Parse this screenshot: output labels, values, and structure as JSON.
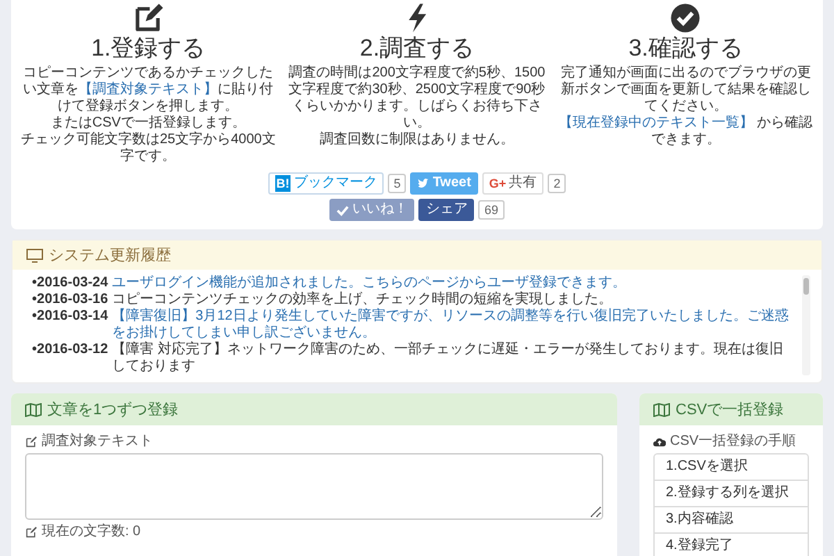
{
  "steps": [
    {
      "kind": "edit",
      "title": "1.登録する",
      "paragraphs": [
        [
          {
            "text": "コピーコンテンツであるかチェックしたい文章を",
            "link": false
          },
          {
            "text": "【調査対象テキスト】",
            "link": true
          },
          {
            "text": "に貼り付けて登録ボタンを押します。",
            "link": false
          }
        ],
        [
          {
            "text": "またはCSVで一括登録します。",
            "link": false
          }
        ],
        [
          {
            "text": "チェック可能文字数は25文字から4000文字です。",
            "link": false
          }
        ]
      ]
    },
    {
      "kind": "bolt",
      "title": "2.調査する",
      "paragraphs": [
        [
          {
            "text": "調査の時間は200文字程度で約5秒、1500文字程度で約30秒、2500文字程度で90秒くらいかかります。しばらくお待ち下さい。",
            "link": false
          }
        ],
        [
          {
            "text": "調査回数に制限はありません。",
            "link": false
          }
        ]
      ]
    },
    {
      "kind": "check",
      "title": "3.確認する",
      "paragraphs": [
        [
          {
            "text": "完了通知が画面に出るのでブラウザの更新ボタンで画面を更新して結果を確認してください。",
            "link": false
          }
        ],
        [
          {
            "text": "【現在登録中のテキスト一覧】",
            "link": true
          },
          {
            "text": " から確認できます。",
            "link": false
          }
        ]
      ]
    }
  ],
  "social": [
    [
      {
        "kind": "hatena",
        "icon": "B!",
        "label": "ブックマーク",
        "count": "5"
      },
      {
        "kind": "twitter",
        "label": "Tweet"
      },
      {
        "kind": "google",
        "icon": "G+",
        "label": "共有",
        "count": "2"
      }
    ],
    [
      {
        "kind": "like",
        "label": "いいね！"
      },
      {
        "kind": "share",
        "label": "シェア",
        "count": "69"
      }
    ]
  ],
  "history": {
    "title": "システム更新履歴",
    "items": [
      {
        "date": "•2016-03-24",
        "text": "ユーザログイン機能が追加されました。こちらのページからユーザ登録できます。",
        "link": true
      },
      {
        "date": "•2016-03-16",
        "text": "コピーコンテンツチェックの効率を上げ、チェック時間の短縮を実現しました。",
        "link": false
      },
      {
        "date": "•2016-03-14",
        "text": "【障害復旧】3月12日より発生していた障害ですが、リソースの調整等を行い復旧完了いたしました。ご迷惑をお掛けしてしまい申し訳ございません。",
        "link": true
      },
      {
        "date": "•2016-03-12",
        "text": "【障害 対応完了】ネットワーク障害のため、一部チェックに遅延・エラーが発生しております。現在は復旧しております",
        "link": false
      }
    ]
  },
  "single_entry": {
    "title": "文章を1つずつ登録",
    "field_label": "調査対象テキスト",
    "counter": "現在の文字数: 0"
  },
  "csv": {
    "title": "CSVで一括登録",
    "steps_label": "CSV一括登録の手順",
    "steps": [
      "1.CSVを選択",
      "2.登録する列を選択",
      "3.内容確認",
      "4.登録完了"
    ]
  }
}
